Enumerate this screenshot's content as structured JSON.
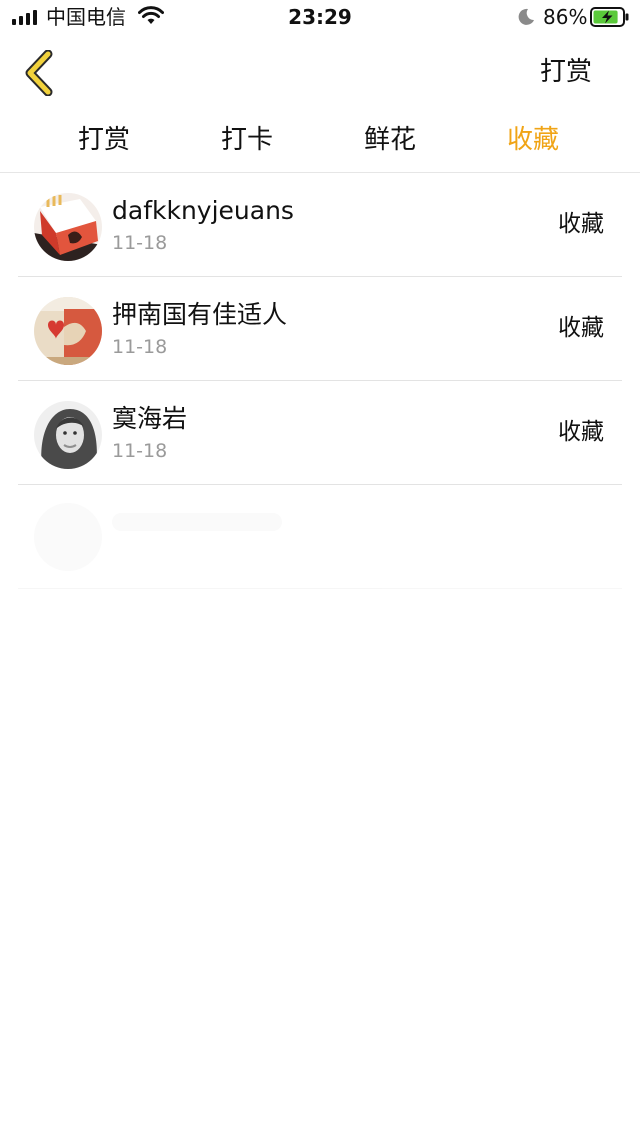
{
  "status_bar": {
    "carrier": "中国电信",
    "time": "23:29",
    "battery_percent": "86%",
    "battery_level": 0.86,
    "battery_charging": true,
    "signal_bars": 4,
    "wifi": "wifi-icon",
    "do_not_disturb": "moon-icon"
  },
  "nav": {
    "back_icon": "chevron-left-icon",
    "action_label": "打赏"
  },
  "tabs": [
    {
      "label": "打赏",
      "active": false
    },
    {
      "label": "打卡",
      "active": false
    },
    {
      "label": "鲜花",
      "active": false
    },
    {
      "label": "收藏",
      "active": true
    }
  ],
  "list": {
    "items": [
      {
        "name": "dafkknyjeuans",
        "date": "11-18",
        "action": "收藏"
      },
      {
        "name": "押南国有佳适人",
        "date": "11-18",
        "action": "收藏"
      },
      {
        "name": "寞海岩",
        "date": "11-18",
        "action": "收藏"
      }
    ]
  },
  "colors": {
    "accent": "#f0a416",
    "text": "#111111",
    "subtext": "#9a9a9a",
    "divider": "#e3e3e3",
    "battery_fill": "#5ac93a",
    "back_chevron": "#f2d23c"
  }
}
